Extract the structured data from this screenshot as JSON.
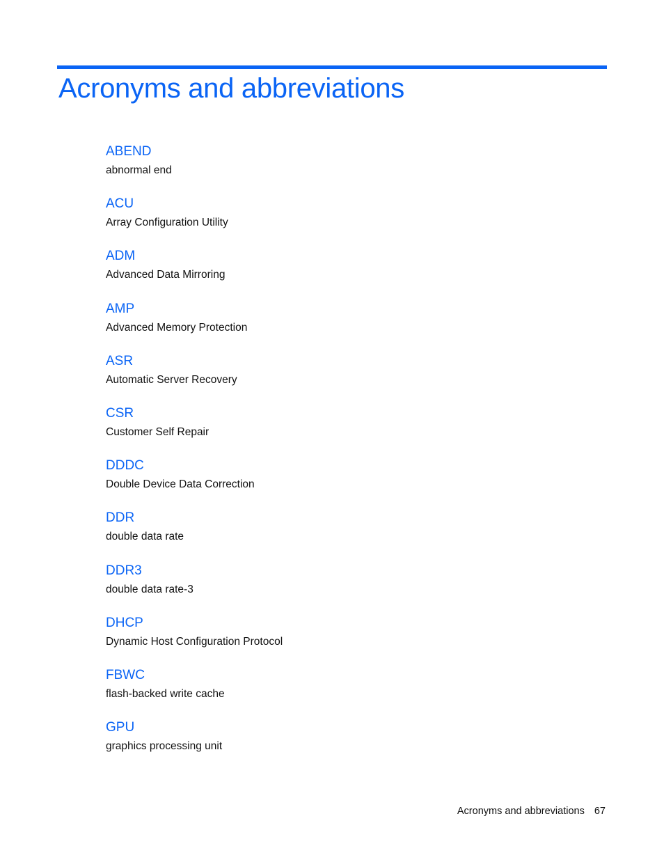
{
  "page": {
    "title": "Acronyms and abbreviations",
    "accent_color": "#0a64f5"
  },
  "entries": [
    {
      "term": "ABEND",
      "definition": "abnormal end"
    },
    {
      "term": "ACU",
      "definition": "Array Configuration Utility"
    },
    {
      "term": "ADM",
      "definition": "Advanced Data Mirroring"
    },
    {
      "term": "AMP",
      "definition": "Advanced Memory Protection"
    },
    {
      "term": "ASR",
      "definition": "Automatic Server Recovery"
    },
    {
      "term": "CSR",
      "definition": "Customer Self Repair"
    },
    {
      "term": "DDDC",
      "definition": "Double Device Data Correction"
    },
    {
      "term": "DDR",
      "definition": "double data rate"
    },
    {
      "term": "DDR3",
      "definition": "double data rate-3"
    },
    {
      "term": "DHCP",
      "definition": "Dynamic Host Configuration Protocol"
    },
    {
      "term": "FBWC",
      "definition": "flash-backed write cache"
    },
    {
      "term": "GPU",
      "definition": "graphics processing unit"
    }
  ],
  "footer": {
    "section": "Acronyms and abbreviations",
    "page_number": "67"
  }
}
